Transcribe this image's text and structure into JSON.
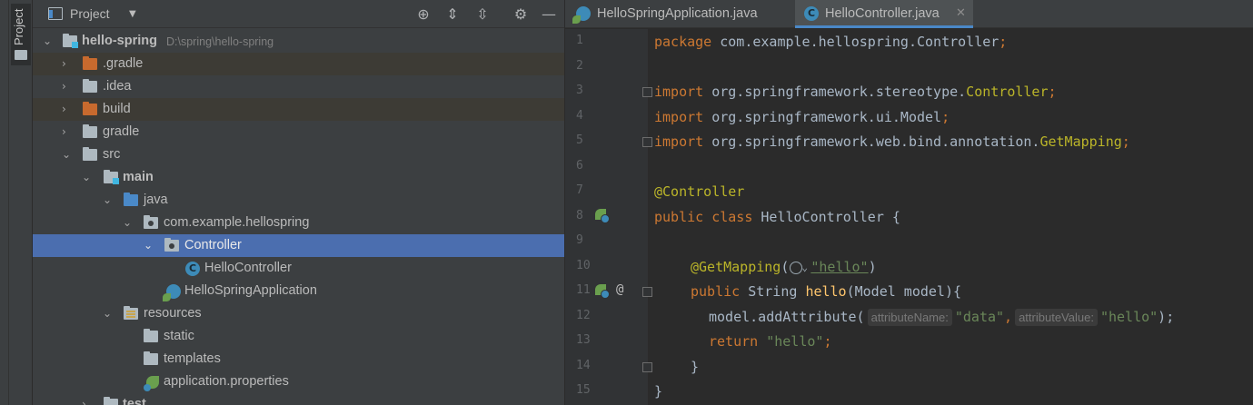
{
  "tool_strip": {
    "label": "Project"
  },
  "project_panel": {
    "title": "Project",
    "header_icons": [
      "locate-icon",
      "expand-all-icon",
      "collapse-all-icon",
      "gear-icon",
      "minimize-icon"
    ],
    "tree": [
      {
        "label": "hello-spring",
        "path": "D:\\spring\\hello-spring",
        "expanded": true
      },
      {
        "label": ".gradle"
      },
      {
        "label": ".idea"
      },
      {
        "label": "build"
      },
      {
        "label": "gradle"
      },
      {
        "label": "src"
      },
      {
        "label": "main"
      },
      {
        "label": "java"
      },
      {
        "label": "com.example.hellospring"
      },
      {
        "label": "Controller",
        "selected": true
      },
      {
        "label": "HelloController"
      },
      {
        "label": "HelloSpringApplication"
      },
      {
        "label": "resources"
      },
      {
        "label": "static"
      },
      {
        "label": "templates"
      },
      {
        "label": "application.properties"
      },
      {
        "label": "test"
      }
    ]
  },
  "tabs": [
    {
      "label": "HelloSpringApplication.java",
      "active": false
    },
    {
      "label": "HelloController.java",
      "active": true
    }
  ],
  "editor": {
    "line_numbers": [
      "1",
      "2",
      "3",
      "4",
      "5",
      "6",
      "7",
      "8",
      "9",
      "10",
      "11",
      "12",
      "13",
      "14",
      "15"
    ],
    "code": {
      "l1_kw": "package",
      "l1_rest": " com.example.hellospring.Controller",
      "l1_semi": ";",
      "l3_kw": "import",
      "l3_pkg": " org.springframework.stereotype.",
      "l3_cls": "Controller",
      "l3_semi": ";",
      "l4_kw": "import",
      "l4_pkg": " org.springframework.ui.Model",
      "l4_semi": ";",
      "l5_kw": "import",
      "l5_pkg": " org.springframework.web.bind.annotation.",
      "l5_cls": "GetMapping",
      "l5_semi": ";",
      "l7_ann": "@Controller",
      "l8_kw": "public class",
      "l8_rest": " HelloController {",
      "l10_ann": "@GetMapping",
      "l10_open": "(",
      "l10_str": "\"hello\"",
      "l10_close": ")",
      "l11_kw": "public",
      "l11_type": " String ",
      "l11_meth": "hello",
      "l11_rest": "(Model model){",
      "l12_call": "model.addAttribute(",
      "l12_hint1": "attributeName:",
      "l12_str1": "\"data\"",
      "l12_comma": ",",
      "l12_hint2": "attributeValue:",
      "l12_str2": "\"hello\"",
      "l12_end": ");",
      "l13_kw": "return",
      "l13_str": " \"hello\"",
      "l13_semi": ";",
      "l14": "}",
      "l15": "}"
    }
  }
}
